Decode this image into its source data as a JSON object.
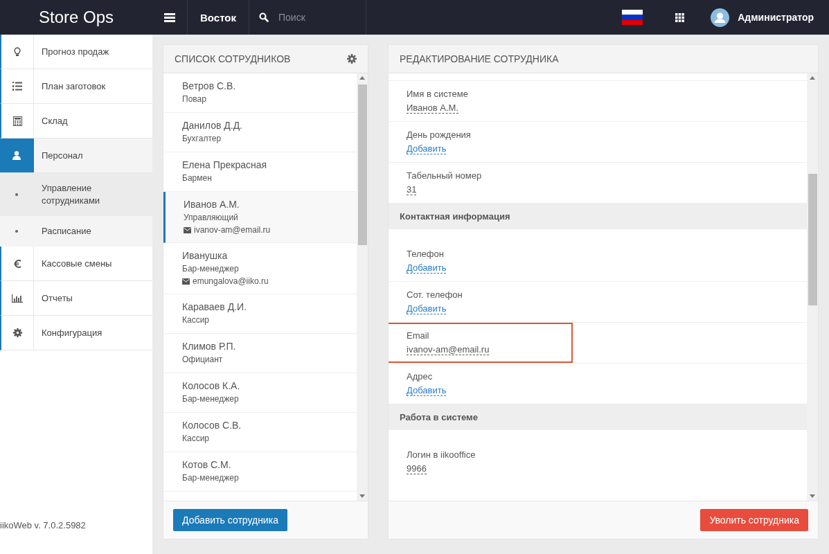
{
  "topbar": {
    "logo": "Store Ops",
    "location": "Восток",
    "search": {
      "placeholder": "Поиск"
    },
    "user": "Администратор"
  },
  "sidebar": {
    "items": [
      {
        "label": "Прогноз продаж",
        "selected": false
      },
      {
        "label": "План заготовок",
        "selected": false
      },
      {
        "label": "Склад",
        "selected": false
      },
      {
        "label": "Персонал",
        "selected": true,
        "children": [
          {
            "label": "Управление сотрудниками",
            "selected": true
          },
          {
            "label": "Расписание",
            "selected": false
          }
        ]
      },
      {
        "label": "Кассовые смены",
        "selected": false
      },
      {
        "label": "Отчеты",
        "selected": false
      },
      {
        "label": "Конфигурация",
        "selected": false
      }
    ],
    "version": "iikoWeb v. 7.0.2.5982"
  },
  "employee_list": {
    "title": "СПИСОК СОТРУДНИКОВ",
    "items": [
      {
        "name": "Ветров С.В.",
        "role": "Повар",
        "selected": false
      },
      {
        "name": "Данилов Д.Д.",
        "role": "Бухгалтер",
        "selected": false
      },
      {
        "name": "Елена Прекрасная",
        "role": "Бармен",
        "selected": false
      },
      {
        "name": "Иванов А.М.",
        "role": "Управляющий",
        "email": "ivanov-am@email.ru",
        "selected": true
      },
      {
        "name": "Иванушка",
        "role": "Бар-менеджер",
        "email": "emungalova@iiko.ru",
        "selected": false
      },
      {
        "name": "Караваев Д.И.",
        "role": "Кассир",
        "selected": false
      },
      {
        "name": "Климов Р.П.",
        "role": "Официант",
        "selected": false
      },
      {
        "name": "Колосов К.А.",
        "role": "Бар-менеджер",
        "selected": false
      },
      {
        "name": "Колосов С.В.",
        "role": "Кассир",
        "selected": false
      },
      {
        "name": "Котов С.М.",
        "role": "Бар-менеджер",
        "selected": false
      }
    ],
    "add_button": "Добавить сотрудника"
  },
  "editor": {
    "title": "РЕДАКТИРОВАНИЕ СОТРУДНИКА",
    "rows": [
      {
        "kind": "field",
        "label": "Имя в системе",
        "value": "Иванов А.М.",
        "highlighted": false
      },
      {
        "kind": "link_field",
        "label": "День рождения",
        "value": "Добавить",
        "highlighted": false
      },
      {
        "kind": "field",
        "label": "Табельный номер",
        "value": "31",
        "highlighted": false
      },
      {
        "kind": "section",
        "title": "Контактная информация"
      },
      {
        "kind": "link_field",
        "label": "Телефон",
        "value": "Добавить",
        "highlighted": false
      },
      {
        "kind": "link_field",
        "label": "Сот. телефон",
        "value": "Добавить",
        "highlighted": false
      },
      {
        "kind": "field",
        "label": "Email",
        "value": "ivanov-am@email.ru",
        "highlighted": true
      },
      {
        "kind": "link_field",
        "label": "Адрес",
        "value": "Добавить",
        "highlighted": false
      },
      {
        "kind": "section",
        "title": "Работа в системе"
      },
      {
        "kind": "field",
        "label": "Логин в iikooffice",
        "value": "9966",
        "highlighted": false
      }
    ],
    "dismiss_button": "Уволить сотрудника"
  }
}
